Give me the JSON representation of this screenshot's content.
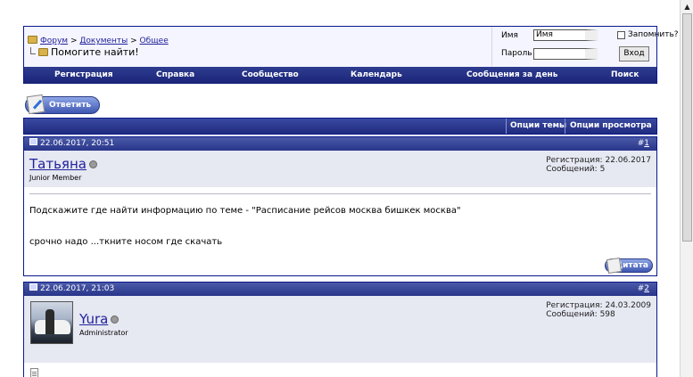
{
  "breadcrumb": {
    "items": [
      "Форум",
      "Документы",
      "Общее"
    ],
    "separator": ">",
    "thread_title": "Помогите найти!"
  },
  "login": {
    "username_label": "Имя",
    "username_value": "Имя",
    "password_label": "Пароль",
    "password_value": "",
    "remember_label": "Запомнить?",
    "login_button": "Вход"
  },
  "navmenu": {
    "items": [
      "Регистрация",
      "Справка",
      "Сообщество",
      "Календарь",
      "Сообщения за день",
      "Поиск"
    ]
  },
  "reply_button": "Ответить",
  "thread_bar": {
    "thread_tools": "Опции темы",
    "display_modes": "Опции просмотра"
  },
  "posts": [
    {
      "date": "22.06.2017, 20:51",
      "number_prefix": "#",
      "number": "1",
      "username": "Татьяна",
      "usertitle": "Junior Member",
      "reg_label": "Регистрация:",
      "reg_date": "22.06.2017",
      "posts_label": "Сообщений:",
      "posts_count": "5",
      "body_line1": "Подскажите где найти информацию по теме - \"Расписание рейсов москва бишкек москва\"",
      "body_line2": "срочно надо ...ткните носом где скачать",
      "quote_button": "Цитата"
    },
    {
      "date": "22.06.2017, 21:03",
      "number_prefix": "#",
      "number": "2",
      "username": "Yura",
      "usertitle": "Administrator",
      "reg_label": "Регистрация:",
      "reg_date": "24.03.2009",
      "posts_label": "Сообщений:",
      "posts_count": "598"
    }
  ],
  "colors": {
    "nav_blue": "#1f2b80",
    "link": "#22229c",
    "user_area": "#e6e8f2"
  }
}
